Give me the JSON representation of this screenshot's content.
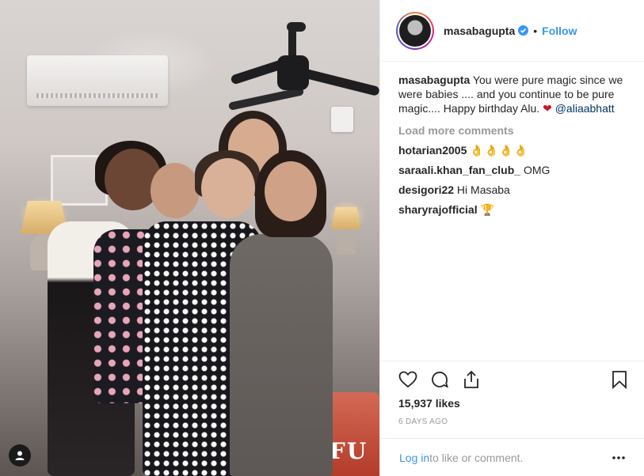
{
  "post": {
    "username": "masabagupta",
    "follow_label": "Follow",
    "separator": "•"
  },
  "caption": {
    "username": "masabagupta",
    "text": "You were pure magic since we were babies .... and you continue to be pure magic.... Happy birthday Alu.",
    "heart": "❤",
    "mention": "@aliaabhatt"
  },
  "load_more_label": "Load more comments",
  "comments": [
    {
      "username": "hotarian2005",
      "text": "👌👌👌👌"
    },
    {
      "username": "saraali.khan_fan_club_",
      "text": "OMG"
    },
    {
      "username": "desigori22",
      "text": "Hi Masaba"
    },
    {
      "username": "sharyrajofficial",
      "text": "🏆"
    }
  ],
  "likes": "15,937 likes",
  "time": "6 DAYS AGO",
  "footer": {
    "login": "Log in",
    "rest": " to like or comment."
  },
  "photo": {
    "drum_text": "FU"
  },
  "colors": {
    "accent": "#3897f0",
    "muted": "#999999",
    "text": "#262626"
  }
}
